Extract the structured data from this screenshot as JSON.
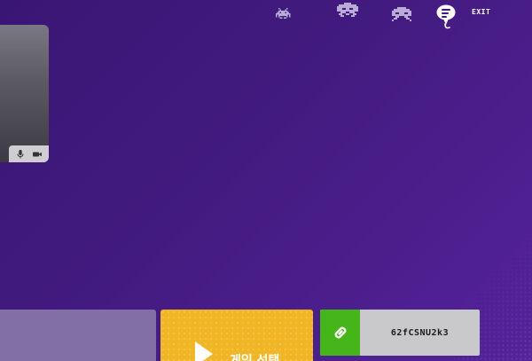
{
  "topbar": {
    "players": [
      {
        "icon": "space-invader-icon",
        "color": "#b9acd6"
      },
      {
        "icon": "space-invader-icon",
        "color": "#b9acd6"
      },
      {
        "icon": "space-invader-icon",
        "color": "#b9acd6"
      }
    ],
    "chat_icon": "chat-bubble-icon",
    "exit_label": "EXIT"
  },
  "video": {
    "mic_icon": "microphone-icon",
    "camera_icon": "video-camera-icon"
  },
  "actions": {
    "select_game_label": "게임 선택",
    "select_game_icon": "play-icon",
    "room_code": "62fCSNU2k3",
    "copy_link_icon": "link-icon",
    "colors": {
      "select_game": "#f0b625",
      "copy_link": "#46b51a",
      "code_box": "#c9c9cc"
    }
  },
  "theme": {
    "background": "#431b80"
  }
}
